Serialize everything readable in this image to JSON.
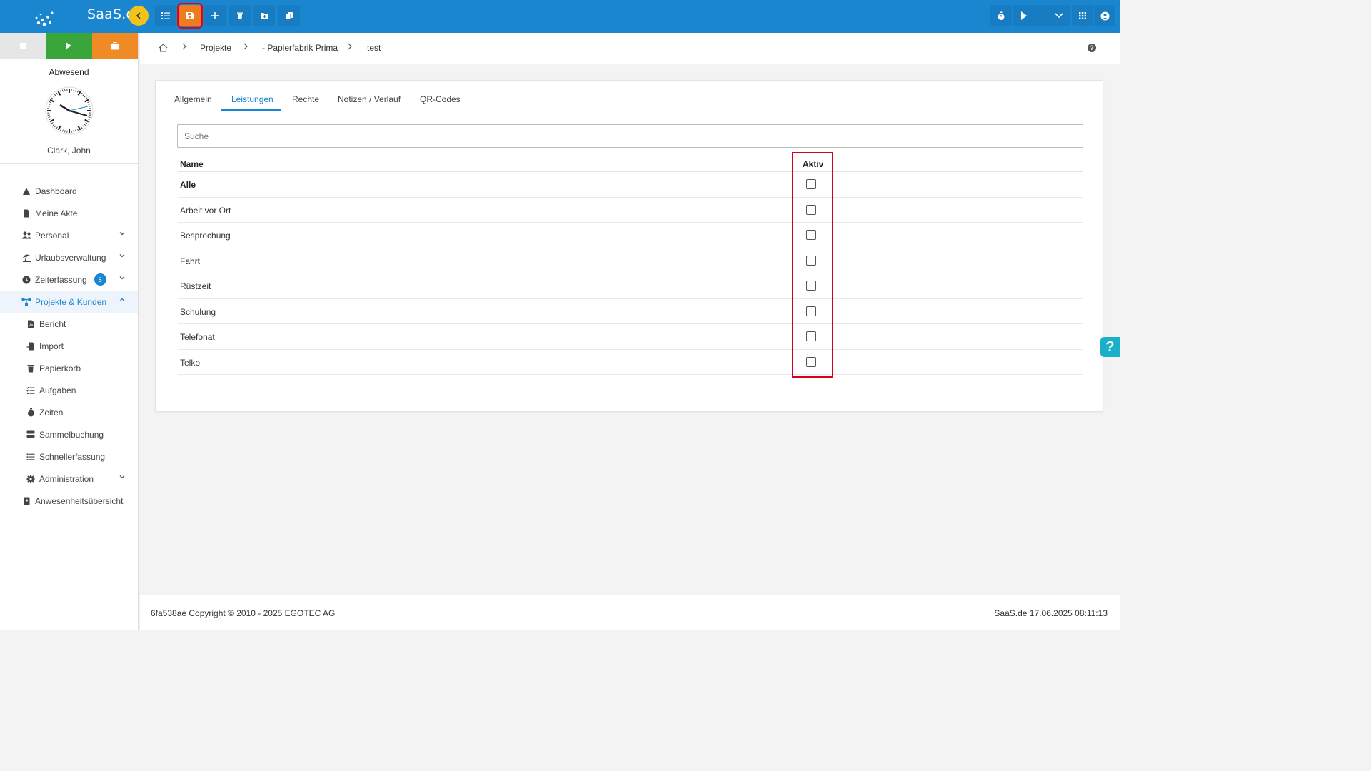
{
  "app": {
    "logo_text": "SaaS.de"
  },
  "toolbar": {
    "back": "back-icon",
    "buttons": [
      "list-icon",
      "save-icon",
      "plus-icon",
      "trash-icon",
      "folder-add-icon",
      "copy-icon"
    ],
    "right": [
      "timer-icon",
      "play-icon",
      "chevron-down-icon",
      "apps-grid-icon",
      "user-icon"
    ]
  },
  "sidebar": {
    "status": "Abwesend",
    "user": "Clark, John",
    "items": [
      {
        "label": "Dashboard"
      },
      {
        "label": "Meine Akte"
      },
      {
        "label": "Personal"
      },
      {
        "label": "Urlaubsverwaltung"
      },
      {
        "label": "Zeiterfassung",
        "badge": "5"
      },
      {
        "label": "Projekte & Kunden"
      },
      {
        "label": "Bericht"
      },
      {
        "label": "Import"
      },
      {
        "label": "Papierkorb"
      },
      {
        "label": "Aufgaben"
      },
      {
        "label": "Zeiten"
      },
      {
        "label": "Sammelbuchung"
      },
      {
        "label": "Schnellerfassung"
      },
      {
        "label": "Administration"
      },
      {
        "label": "Anwesenheitsübersicht"
      }
    ]
  },
  "breadcrumb": {
    "items": [
      "Projekte",
      "- Papierfabrik Prima",
      "test"
    ]
  },
  "tabs": [
    "Allgemein",
    "Leistungen",
    "Rechte",
    "Notizen / Verlauf",
    "QR-Codes"
  ],
  "search": {
    "placeholder": "Suche",
    "value": ""
  },
  "table": {
    "headers": {
      "name": "Name",
      "aktiv": "Aktiv"
    },
    "rows": [
      {
        "name": "Alle",
        "aktiv": false
      },
      {
        "name": "Arbeit vor Ort",
        "aktiv": false
      },
      {
        "name": "Besprechung",
        "aktiv": false
      },
      {
        "name": "Fahrt",
        "aktiv": false
      },
      {
        "name": "Rüstzeit",
        "aktiv": false
      },
      {
        "name": "Schulung",
        "aktiv": false
      },
      {
        "name": "Telefonat",
        "aktiv": false
      },
      {
        "name": "Telko",
        "aktiv": false
      }
    ]
  },
  "footer": {
    "left": "6fa538ae Copyright © 2010 - 2025 EGOTEC AG",
    "right": "SaaS.de  17.06.2025 08:11:13"
  },
  "colors": {
    "primary": "#1a86d0",
    "save": "#f07a1e",
    "highlight": "#d9001b",
    "back": "#f2c318"
  }
}
